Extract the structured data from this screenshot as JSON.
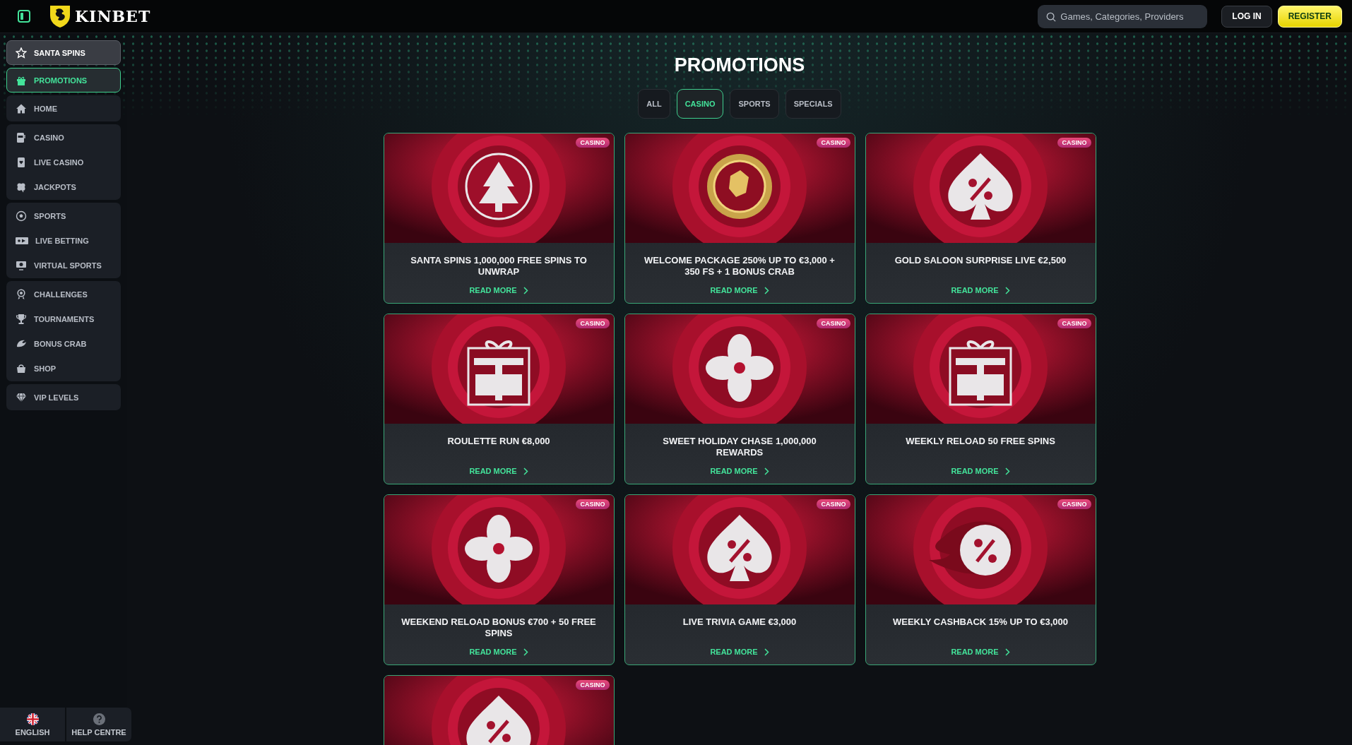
{
  "header": {
    "logo": "KINBET",
    "search": {
      "placeholder": "Games, Categories, Providers"
    },
    "buttons": [
      {
        "label": "LOG IN",
        "kind": "secondary"
      },
      {
        "label": "REGISTER",
        "kind": "primary"
      }
    ]
  },
  "sidebar": {
    "groups": [
      {
        "items": [
          {
            "label": "SANTA SPINS",
            "kind": "featured",
            "selected": false
          }
        ]
      },
      {
        "items": [
          {
            "label": "PROMOTIONS",
            "kind": "link",
            "selected": true
          }
        ]
      },
      {
        "items": [
          {
            "label": "HOME",
            "kind": "link",
            "selected": false
          }
        ]
      },
      {
        "items": [
          {
            "label": "CASINO",
            "kind": "link",
            "selected": false
          },
          {
            "label": "LIVE CASINO",
            "kind": "link",
            "selected": false
          },
          {
            "label": "JACKPOTS",
            "kind": "link",
            "selected": false
          }
        ]
      },
      {
        "items": [
          {
            "label": "SPORTS",
            "kind": "link",
            "selected": false
          },
          {
            "label": "LIVE BETTING",
            "kind": "link",
            "selected": false
          },
          {
            "label": "VIRTUAL SPORTS",
            "kind": "link",
            "selected": false
          }
        ]
      },
      {
        "items": [
          {
            "label": "CHALLENGES",
            "kind": "link",
            "selected": false
          },
          {
            "label": "TOURNAMENTS",
            "kind": "link",
            "selected": false
          },
          {
            "label": "BONUS CRAB",
            "kind": "link",
            "selected": false
          },
          {
            "label": "SHOP",
            "kind": "link",
            "selected": false
          }
        ]
      },
      {
        "items": [
          {
            "label": "VIP LEVELS",
            "kind": "link",
            "selected": false
          }
        ]
      }
    ],
    "footer": [
      {
        "label": "ENGLISH"
      },
      {
        "label": "HELP CENTRE"
      }
    ]
  },
  "page": {
    "title": "PROMOTIONS",
    "tabs": [
      {
        "label": "ALL",
        "selected": false
      },
      {
        "label": "CASINO",
        "selected": true
      },
      {
        "label": "SPORTS",
        "selected": false
      },
      {
        "label": "SPECIALS",
        "selected": false
      }
    ],
    "promotions": [
      {
        "badge": "CASINO",
        "title": "SANTA SPINS 1,000,000 FREE SPINS TO UNWRAP",
        "link": "READ MORE"
      },
      {
        "badge": "CASINO",
        "title": "WELCOME PACKAGE 250% UP TO €3,000 + 350 FS + 1 BONUS CRAB",
        "link": "READ MORE"
      },
      {
        "badge": "CASINO",
        "title": "GOLD SALOON SURPRISE LIVE €2,500",
        "link": "READ MORE"
      },
      {
        "badge": "CASINO",
        "title": "ROULETTE RUN €8,000",
        "link": "READ MORE"
      },
      {
        "badge": "CASINO",
        "title": "SWEET HOLIDAY CHASE 1,000,000 REWARDS",
        "link": "READ MORE"
      },
      {
        "badge": "CASINO",
        "title": "WEEKLY RELOAD 50 FREE SPINS",
        "link": "READ MORE"
      },
      {
        "badge": "CASINO",
        "title": "WEEKEND RELOAD BONUS €700 + 50 FREE SPINS",
        "link": "READ MORE"
      },
      {
        "badge": "CASINO",
        "title": "LIVE TRIVIA GAME €3,000",
        "link": "READ MORE"
      },
      {
        "badge": "CASINO",
        "title": "WEEKLY CASHBACK 15% UP TO €3,000",
        "link": "READ MORE"
      },
      {
        "badge": "CASINO"
      }
    ]
  }
}
